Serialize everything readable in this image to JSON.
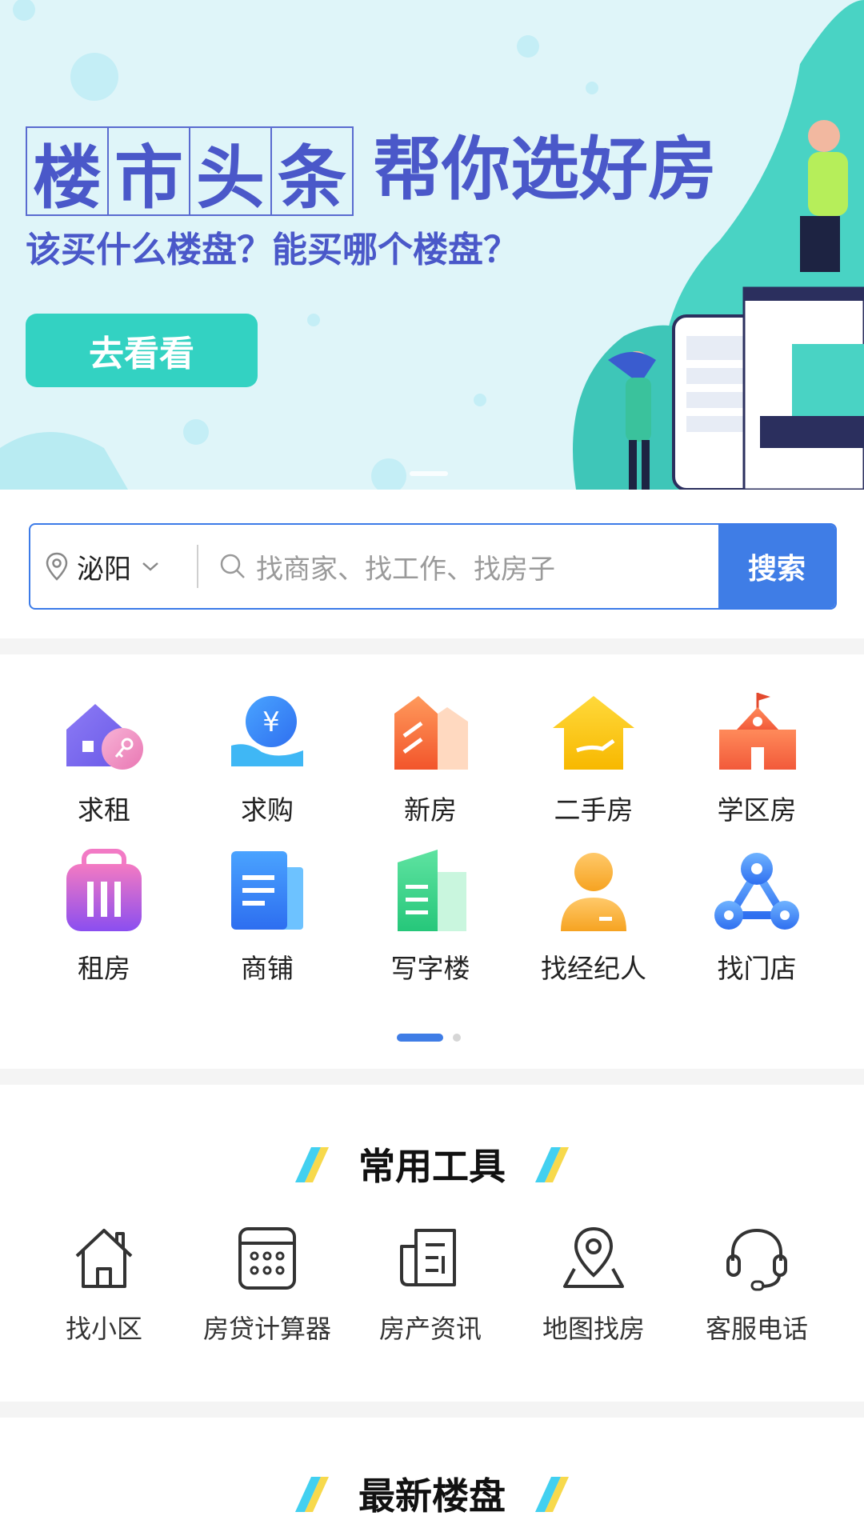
{
  "banner": {
    "title_boxed": [
      "楼",
      "市",
      "头",
      "条"
    ],
    "title_tail": "帮你选好房",
    "subtitle": "该买什么楼盘？能买哪个楼盘？",
    "cta_label": "去看看"
  },
  "search": {
    "city": "泌阳",
    "placeholder": "找商家、找工作、找房子",
    "button_label": "搜索"
  },
  "categories": [
    {
      "label": "求租",
      "icon": "house-key-icon"
    },
    {
      "label": "求购",
      "icon": "yuan-hand-icon"
    },
    {
      "label": "新房",
      "icon": "new-house-icon"
    },
    {
      "label": "二手房",
      "icon": "second-hand-house-icon"
    },
    {
      "label": "学区房",
      "icon": "school-icon"
    },
    {
      "label": "租房",
      "icon": "luggage-icon"
    },
    {
      "label": "商铺",
      "icon": "shop-doc-icon"
    },
    {
      "label": "写字楼",
      "icon": "office-building-icon"
    },
    {
      "label": "找经纪人",
      "icon": "agent-icon"
    },
    {
      "label": "找门店",
      "icon": "store-network-icon"
    }
  ],
  "tools_section": {
    "title": "常用工具",
    "items": [
      {
        "label": "找小区",
        "icon": "house-outline-icon"
      },
      {
        "label": "房贷计算器",
        "icon": "calculator-icon"
      },
      {
        "label": "房产资讯",
        "icon": "news-icon"
      },
      {
        "label": "地图找房",
        "icon": "map-pin-icon"
      },
      {
        "label": "客服电话",
        "icon": "headset-icon"
      }
    ]
  },
  "latest_section": {
    "title": "最新楼盘"
  },
  "colors": {
    "accent": "#3f7de6",
    "banner_text": "#4a58c9",
    "cta": "#33d2c2"
  }
}
